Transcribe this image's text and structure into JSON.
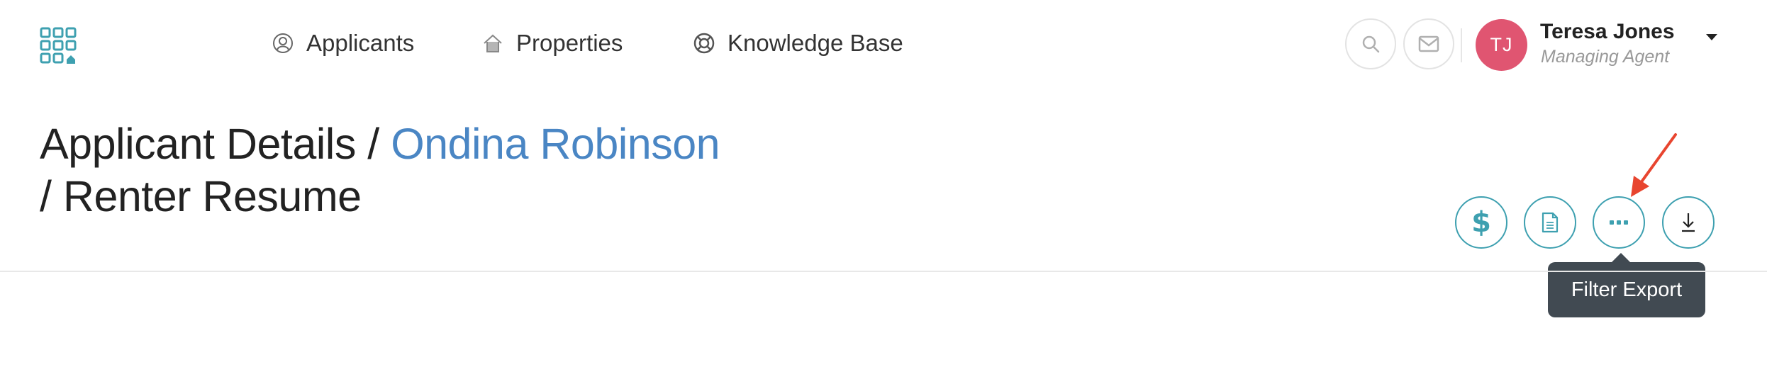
{
  "nav": {
    "applicants": "Applicants",
    "properties": "Properties",
    "knowledge_base": "Knowledge Base"
  },
  "user": {
    "initials": "TJ",
    "name": "Teresa Jones",
    "role": "Managing Agent",
    "avatar_color": "#e05571"
  },
  "title": {
    "prefix": "Applicant Details / ",
    "link": "Ondina Robinson",
    "suffix": "/ Renter Resume",
    "link_color": "#4a86c4"
  },
  "actions": {
    "payment_icon": "dollar-icon",
    "document_icon": "document-icon",
    "more_icon": "more-icon",
    "download_icon": "download-icon",
    "accent_color": "#3ea0b0"
  },
  "tooltip": {
    "text": "Filter Export"
  },
  "icons": {
    "logo": "grid-logo-icon",
    "search": "search-icon",
    "mail": "mail-icon",
    "caret": "caret-down-icon"
  },
  "colors": {
    "brand": "#3ea0b0",
    "annotation": "#e8452f",
    "tooltip_bg": "#414a52"
  }
}
